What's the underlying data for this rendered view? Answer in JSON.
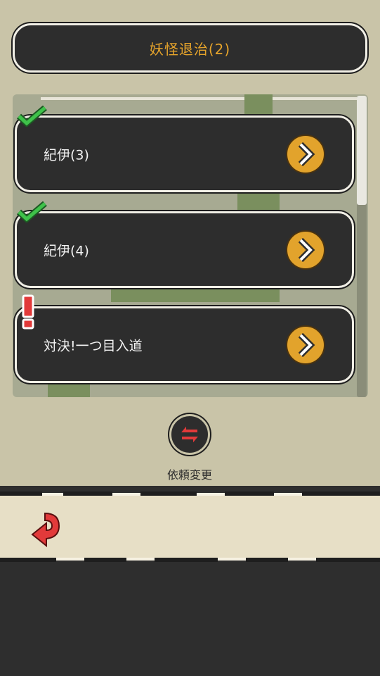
{
  "title": "妖怪退治(2)",
  "quests": [
    {
      "label": "紀伊(3)",
      "status": "cleared"
    },
    {
      "label": "紀伊(4)",
      "status": "cleared"
    },
    {
      "label": "対決!一つ目入道",
      "status": "new"
    }
  ],
  "refresh": {
    "label": "依頼変更"
  },
  "icons": {
    "cleared": "check-icon",
    "new": "exclamation-icon",
    "go": "chevron-right-icon",
    "refresh": "swap-arrows-icon",
    "back": "return-arrow-icon"
  },
  "colors": {
    "accent": "#e2a32c",
    "check": "#3fc24a",
    "alert": "#e23a3a",
    "panel": "#2d2d2d",
    "background": "#c9c4a8"
  }
}
